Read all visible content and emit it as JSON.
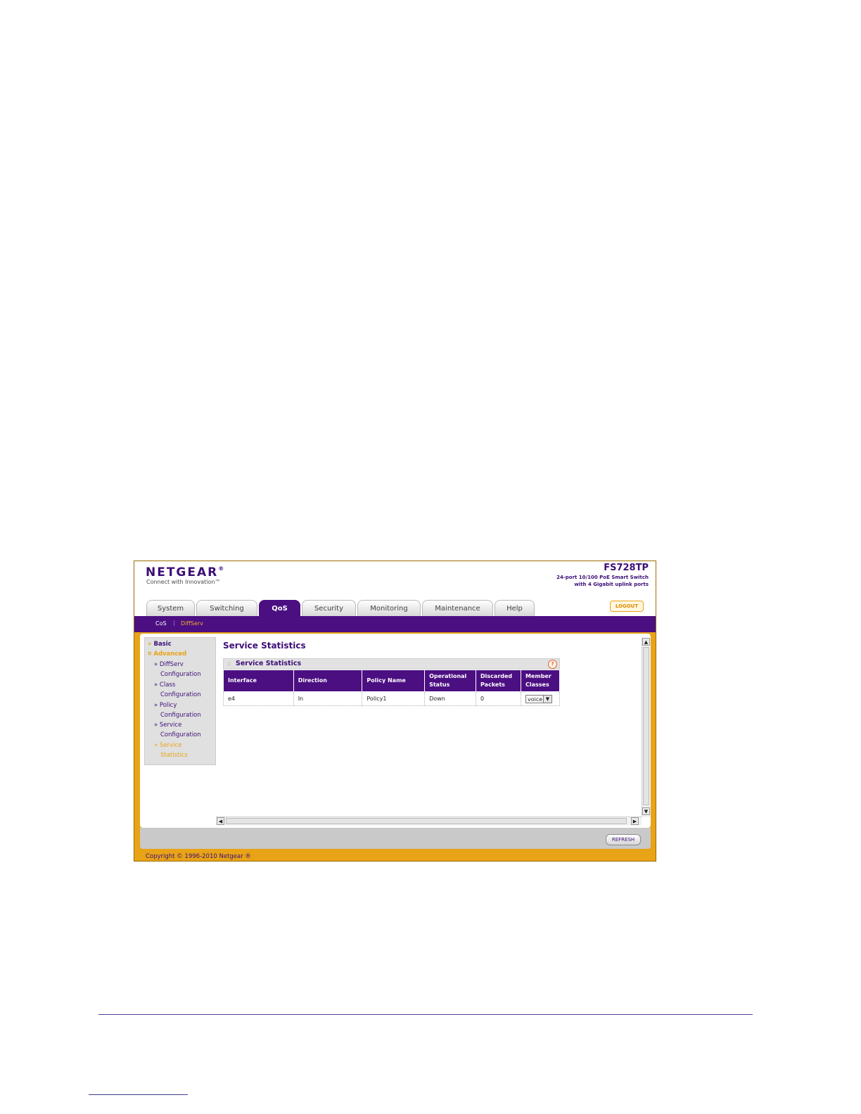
{
  "brand": {
    "logo": "NETGEAR",
    "logo_mark": "®",
    "tagline": "Connect with Innovation™",
    "model": "FS728TP",
    "model_desc_line1": "24-port 10/100 PoE Smart Switch",
    "model_desc_line2": "with 4 Gigabit uplink ports"
  },
  "tabs": [
    {
      "label": "System"
    },
    {
      "label": "Switching"
    },
    {
      "label": "QoS"
    },
    {
      "label": "Security"
    },
    {
      "label": "Monitoring"
    },
    {
      "label": "Maintenance"
    },
    {
      "label": "Help"
    }
  ],
  "active_tab": "QoS",
  "logout_label": "LOGOUT",
  "subnav": [
    {
      "label": "CoS"
    },
    {
      "label": "DiffServ"
    }
  ],
  "sidebar": {
    "basic": "Basic",
    "advanced": "Advanced",
    "items": [
      {
        "line1": "DiffServ",
        "line2": "Configuration"
      },
      {
        "line1": "Class",
        "line2": "Configuration"
      },
      {
        "line1": "Policy",
        "line2": "Configuration"
      },
      {
        "line1": "Service",
        "line2": "Configuration"
      },
      {
        "line1": "Service",
        "line2": "Statistics"
      }
    ],
    "bullet_expand": "»",
    "bullet_collapse": "¤"
  },
  "page_title": "Service Statistics",
  "panel": {
    "title": "Service Statistics",
    "help": "?"
  },
  "table": {
    "headers": [
      [
        "Interface"
      ],
      [
        "Direction"
      ],
      [
        "Policy Name"
      ],
      [
        "Operational",
        "Status"
      ],
      [
        "Discarded",
        "Packets"
      ],
      [
        "Member",
        "Classes"
      ]
    ],
    "rows": [
      {
        "interface": "e4",
        "direction": "In",
        "policy": "Policy1",
        "status": "Down",
        "discarded": "0",
        "member": "voice"
      }
    ]
  },
  "refresh_label": "REFRESH",
  "copyright": "Copyright © 1996-2010 Netgear ®",
  "colors": {
    "brand_purple": "#4b0f82",
    "accent_orange": "#e8a317"
  }
}
